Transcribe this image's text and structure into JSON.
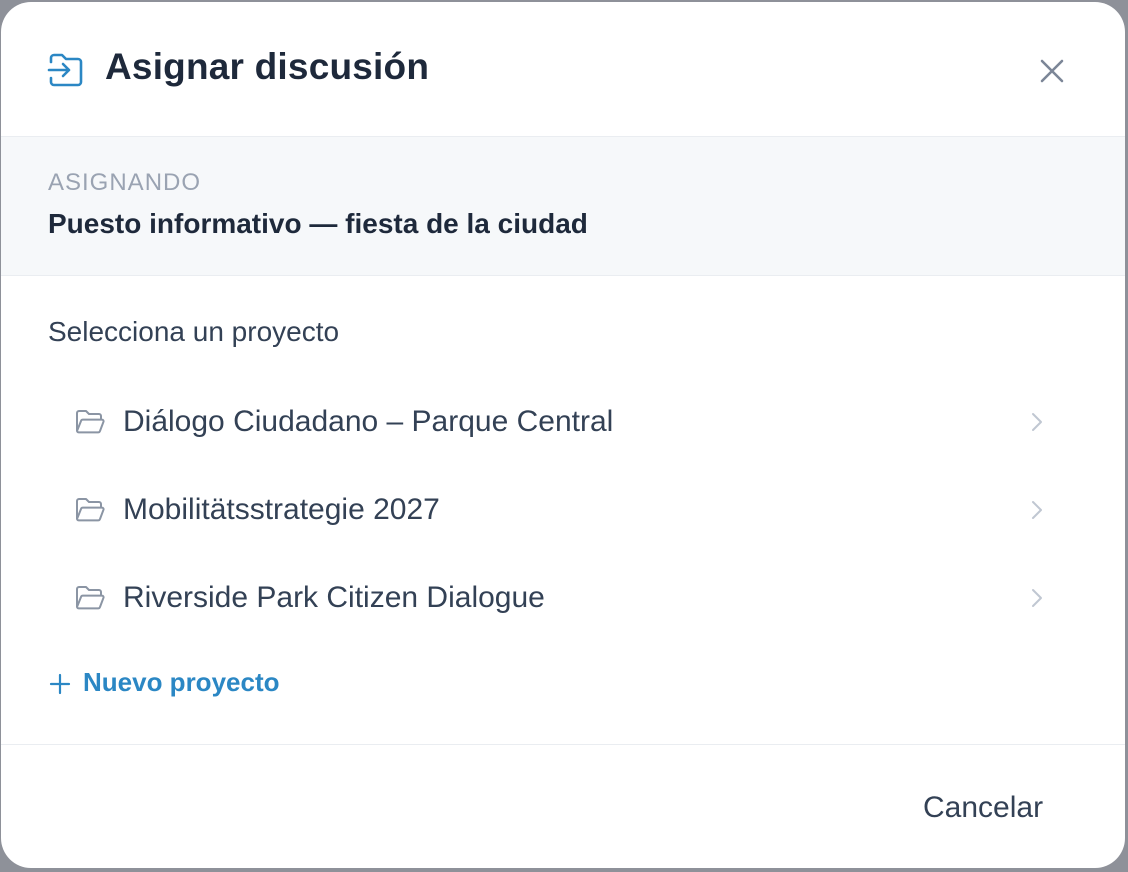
{
  "dialog": {
    "title": "Asignar discusión",
    "title_icon": "assign-arrow-icon",
    "close_icon": "close-icon"
  },
  "context": {
    "label": "ASIGNANDO",
    "value": "Puesto informativo — fiesta de la ciudad"
  },
  "projects": {
    "section_label": "Selecciona un proyecto",
    "items": [
      {
        "label": "Diálogo Ciudadano – Parque Central",
        "icon": "folder-open-icon"
      },
      {
        "label": "Mobilitätsstrategie 2027",
        "icon": "folder-open-icon"
      },
      {
        "label": "Riverside Park Citizen Dialogue",
        "icon": "folder-open-icon"
      }
    ],
    "new_project_label": "Nuevo proyecto"
  },
  "footer": {
    "cancel_label": "Cancelar"
  },
  "colors": {
    "accent": "#2b87c4",
    "text_primary": "#1e293b",
    "text_secondary": "#334155",
    "muted": "#9aa3b2",
    "context_bg": "#f6f8fa"
  }
}
